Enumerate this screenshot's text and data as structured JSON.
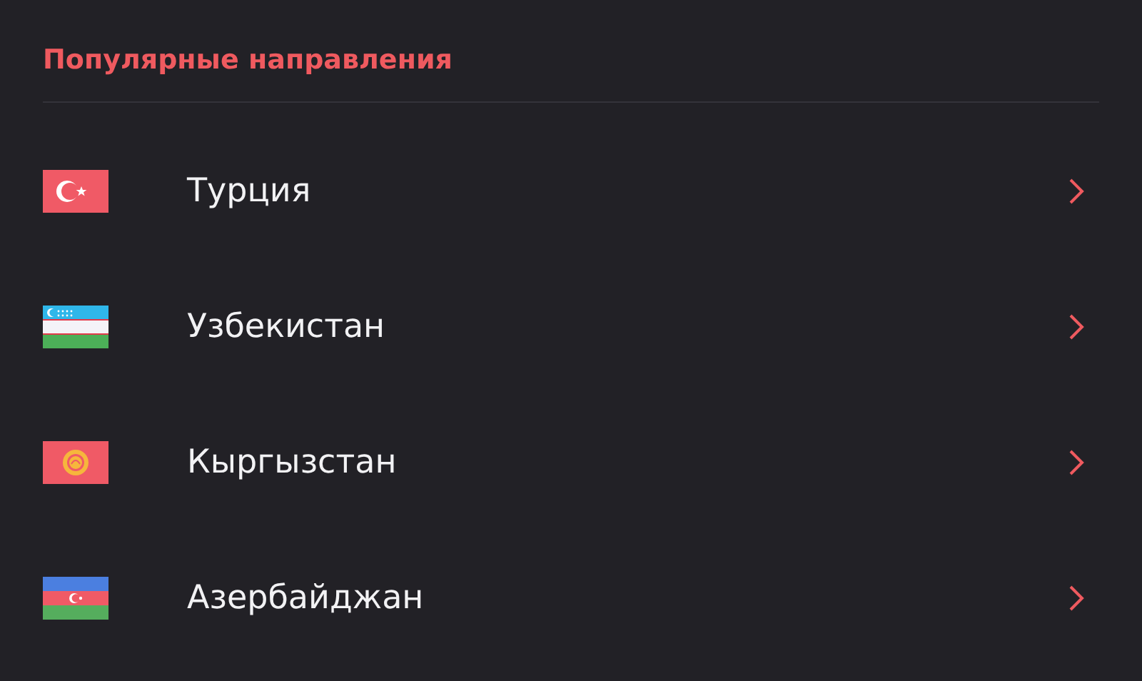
{
  "section": {
    "title": "Популярные направления"
  },
  "destinations": [
    {
      "name": "Турция",
      "kind": "tr"
    },
    {
      "name": "Узбекистан",
      "kind": "uz"
    },
    {
      "name": "Кыргызстан",
      "kind": "kg"
    },
    {
      "name": "Азербайджан",
      "kind": "az"
    }
  ]
}
